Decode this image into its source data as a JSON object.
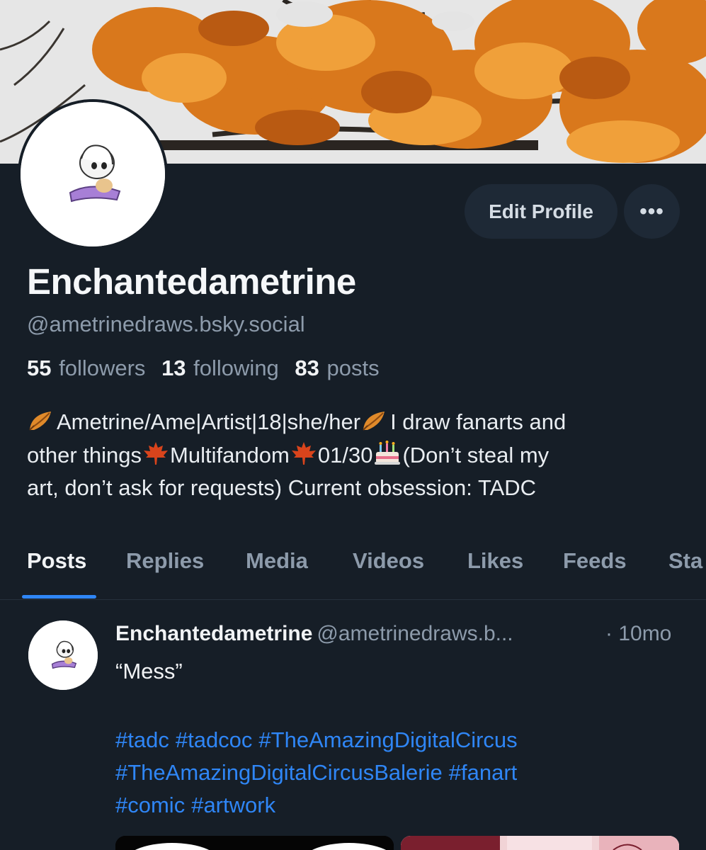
{
  "profile": {
    "display_name": "Enchantedametrine",
    "handle": "@ametrinedraws.bsky.social",
    "stats": {
      "followers_count": "55",
      "followers_label": "followers",
      "following_count": "13",
      "following_label": "following",
      "posts_count": "83",
      "posts_label": "posts"
    },
    "bio": {
      "line1_a": "Ametrine/Ame|Artist|18|she/her",
      "line1_b": "I draw fanarts and",
      "line2_a": "other things",
      "line2_b": "Multifandom",
      "line2_c": "01/30",
      "line2_d": "(Don’t steal my",
      "line3": "art, don’t ask for requests) Current obsession: TADC"
    }
  },
  "actions": {
    "edit_profile_label": "Edit Profile",
    "more_label": "•••"
  },
  "tabs": [
    {
      "label": "Posts",
      "active": true
    },
    {
      "label": "Replies",
      "active": false
    },
    {
      "label": "Media",
      "active": false
    },
    {
      "label": "Videos",
      "active": false
    },
    {
      "label": "Likes",
      "active": false
    },
    {
      "label": "Feeds",
      "active": false
    },
    {
      "label": "Sta",
      "active": false
    }
  ],
  "post": {
    "author": "Enchantedametrine",
    "handle": "@ametrinedraws.b...",
    "time": "· 10mo",
    "text": "“Mess”",
    "hashtags_line1": [
      "#tadc",
      "#tadcoc",
      "#TheAmazingDigitalCircus"
    ],
    "hashtags_line2": [
      "#TheAmazingDigitalCircusBalerie",
      "#fanart"
    ],
    "hashtags_line3": [
      "#comic",
      "#artwork"
    ]
  },
  "icons": {
    "leaf": "fallen-leaf-icon",
    "maple": "maple-leaf-icon",
    "cake": "birthday-cake-icon",
    "more": "more-horizontal-icon"
  },
  "colors": {
    "background": "#161e27",
    "accent": "#2f86f6",
    "muted_text": "#8d9bab",
    "button_bg": "#1e2936"
  }
}
